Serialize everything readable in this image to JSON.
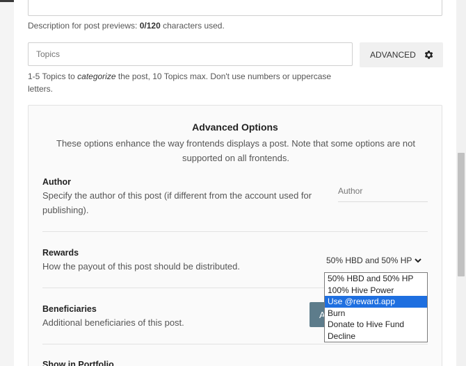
{
  "description": {
    "note_prefix": "Description for post previews: ",
    "count": "0/120",
    "note_suffix": " characters used."
  },
  "topics": {
    "placeholder": "Topics",
    "advanced_label": "ADVANCED",
    "note_part1": "1-5 Topics to ",
    "note_emphasis": "categorize",
    "note_part2": " the post, 10 Topics max. Don't use numbers or uppercase letters."
  },
  "advanced_options": {
    "title": "Advanced Options",
    "subtitle": "These options enhance the way frontends displays a post. Note that some options are not supported on all frontends.",
    "author": {
      "label": "Author",
      "description": "Specify the author of this post (if different from the account used for publishing).",
      "placeholder": "Author"
    },
    "rewards": {
      "label": "Rewards",
      "description": "How the payout of this post should be distributed.",
      "selected": "50% HBD and 50% HP",
      "options": [
        "50% HBD and 50% HP",
        "100% Hive Power",
        "Use @reward.app",
        "Burn",
        "Donate to Hive Fund",
        "Decline"
      ]
    },
    "beneficiaries": {
      "label": "Beneficiaries",
      "description": "Additional beneficiaries of this post.",
      "add_label": "A"
    },
    "portfolio": {
      "label": "Show in Portfolio"
    }
  },
  "colors": {
    "highlight": "#1e6fe0",
    "button": "#5d7c8b"
  },
  "icons": {
    "advanced": "gear-icon",
    "dropdown": "chevron-down-icon"
  }
}
